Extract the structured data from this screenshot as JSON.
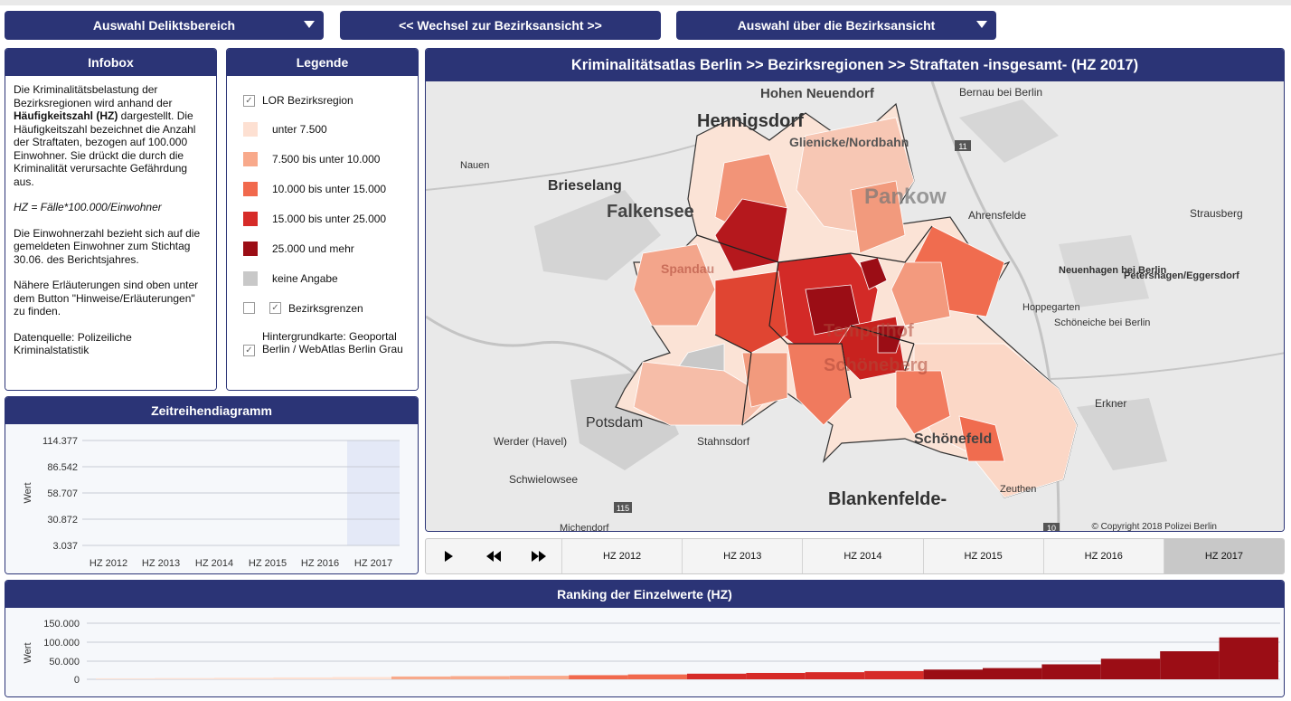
{
  "nav": {
    "delikt_label": "Auswahl Deliktsbereich",
    "wechsel_label": "<< Wechsel zur Bezirksansicht >>",
    "bezirk_label": "Auswahl über die Bezirksansicht"
  },
  "infobox": {
    "title": "Infobox",
    "p1_a": "Die Kriminalitätsbelastung der Bezirksregionen wird anhand der ",
    "p1_b": "Häufigkeitszahl (HZ)",
    "p1_c": " dargestellt. Die Häufigkeitszahl bezeichnet die Anzahl der Straftaten, bezogen auf 100.000 Einwohner. Sie drückt die durch die Kriminalität verursachte Gefährdung aus.",
    "formula": "HZ = Fälle*100.000/Einwohner",
    "p2": "Die Einwohnerzahl bezieht sich auf die gemeldeten Einwohner zum Stichtag 30.06. des Berichtsjahres.",
    "p3": "Nähere Erläuterungen sind oben unter dem Button \"Hinweise/Erläuterungen\" zu finden.",
    "p4": "Datenquelle: Polizeiliche Kriminalstatistik"
  },
  "legend": {
    "title": "Legende",
    "lor": "LOR Bezirksregion",
    "classes": [
      {
        "label": "unter 7.500",
        "color": "#fde0d2"
      },
      {
        "label": "7.500 bis unter 10.000",
        "color": "#f8a98b"
      },
      {
        "label": "10.000 bis unter 15.000",
        "color": "#f1694d"
      },
      {
        "label": "15.000 bis unter 25.000",
        "color": "#d62b28"
      },
      {
        "label": "25.000 und mehr",
        "color": "#9b0d15"
      },
      {
        "label": "keine Angabe",
        "color": "#c8c8c8"
      }
    ],
    "bezirksgrenzen": "Bezirksgrenzen",
    "hintergrund": "Hintergrundkarte: Geoportal Berlin / WebAtlas Berlin Grau"
  },
  "map": {
    "title": "Kriminalitätsatlas Berlin >> Bezirksregionen >>  Straftaten -insgesamt- (HZ 2017)",
    "copyright": "© Copyright 2018 Polizei Berlin",
    "places": [
      "Hohen Neuendorf",
      "Bernau bei Berlin",
      "Hennigsdorf",
      "Glienicke/Nordbahn",
      "Nauen",
      "Brieselang",
      "Falkensee",
      "Pankow",
      "Ahrensfelde",
      "Strausberg",
      "Neuenhagen bei Berlin",
      "Petershagen/Eggersdorf",
      "Hoppegarten",
      "Schöneiche bei Berlin",
      "Erkner",
      "Potsdam",
      "Werder (Havel)",
      "Stahnsdorf",
      "Schwielowsee",
      "Blankenfelde-",
      "Zeuthen",
      "Michendorf",
      "Spandau",
      "Tempelhof",
      "Schöneberg",
      "Schönefeld"
    ],
    "road_badges": [
      "11",
      "115",
      "10"
    ]
  },
  "timeline": {
    "years": [
      "HZ 2012",
      "HZ 2013",
      "HZ 2014",
      "HZ 2015",
      "HZ 2016",
      "HZ 2017"
    ],
    "active": "HZ 2017"
  },
  "zeitreihe": {
    "title": "Zeitreihendiagramm",
    "ylabel": "Wert",
    "yticks": [
      "114.377",
      "86.542",
      "58.707",
      "30.872",
      "3.037"
    ],
    "categories": [
      "HZ 2012",
      "HZ 2013",
      "HZ 2014",
      "HZ 2015",
      "HZ 2016",
      "HZ 2017"
    ],
    "highlight": "HZ 2017"
  },
  "ranking": {
    "title": "Ranking der Einzelwerte (HZ)",
    "ylabel": "Wert",
    "yticks": [
      "150.000",
      "100.000",
      "50.000",
      "0"
    ]
  },
  "chart_data": [
    {
      "type": "line",
      "title": "Zeitreihendiagramm",
      "ylabel": "Wert",
      "categories": [
        "HZ 2012",
        "HZ 2013",
        "HZ 2014",
        "HZ 2015",
        "HZ 2016",
        "HZ 2017"
      ],
      "ylim": [
        3037,
        114377
      ],
      "series": [],
      "grid": true
    },
    {
      "type": "bar",
      "title": "Ranking der Einzelwerte (HZ)",
      "ylabel": "Wert",
      "ylim": [
        0,
        150000
      ],
      "grid": true,
      "values": [
        2500,
        3200,
        4000,
        5000,
        6000,
        7500,
        8500,
        9500,
        11000,
        13000,
        15000,
        17000,
        19000,
        22000,
        26000,
        30000,
        40000,
        55000,
        75000,
        112000
      ]
    }
  ]
}
